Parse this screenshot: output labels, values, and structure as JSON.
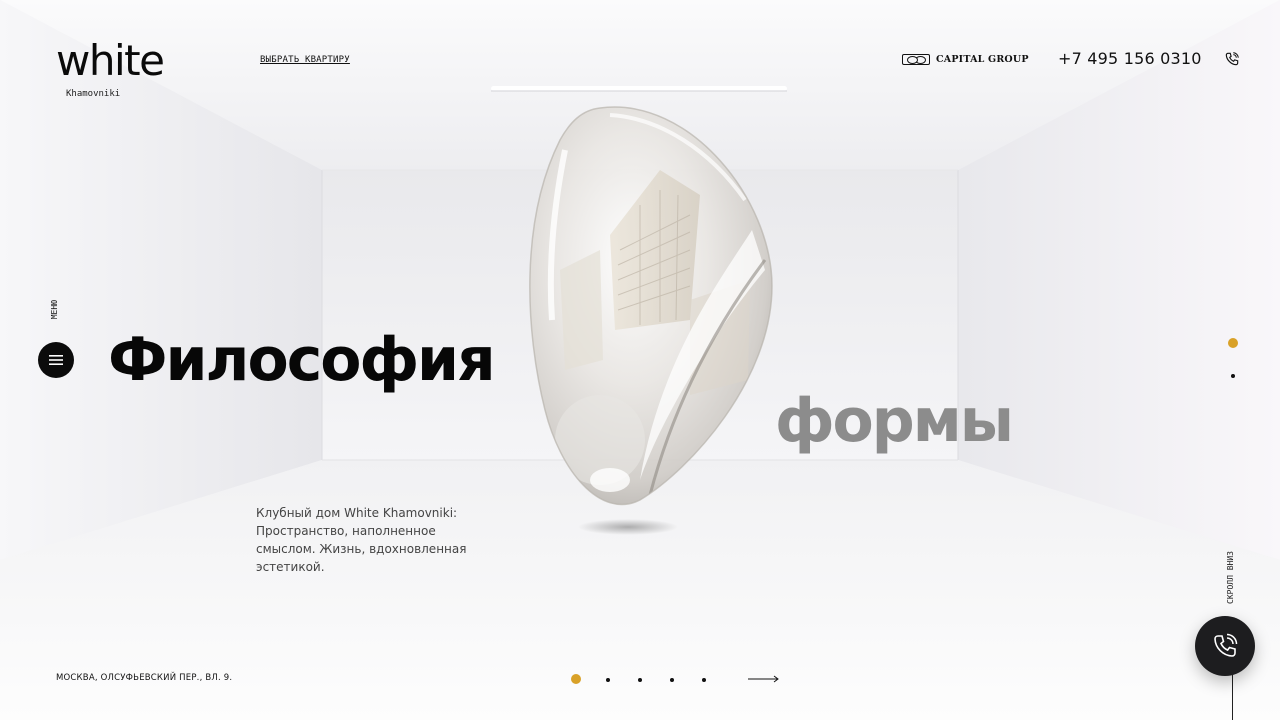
{
  "brand": {
    "logo": "white",
    "subtitle": "Khamovniki"
  },
  "header": {
    "choose_apartment": "ВЫБРАТЬ КВАРТИРУ",
    "partner": "CAPITAL GROUP",
    "phone": "+7 495 156 0310"
  },
  "menu": {
    "label": "МЕНЮ"
  },
  "hero": {
    "title_line1": "Философия",
    "title_line2": "формы",
    "description": "Клубный дом White Khamovniki: Пространство, наполненное смыслом. Жизнь, вдохновленная эстетикой."
  },
  "side": {
    "scroll_label": "СКРОЛЛ ВНИЗ",
    "sections_total": 2,
    "active_section": 1
  },
  "footer": {
    "address": "МОСКВА, ОЛСУФЬЕВСКИЙ ПЕР., ВЛ. 9.",
    "slides_total": 5,
    "active_slide": 1
  },
  "colors": {
    "accent": "#d9a128",
    "text": "#0a0a0a",
    "muted_heading": "#8c8c8c",
    "dark_button": "#1d1d1f"
  },
  "icons": {
    "menu": "hamburger-icon",
    "phone": "phone-call-icon",
    "next": "arrow-right-icon"
  }
}
